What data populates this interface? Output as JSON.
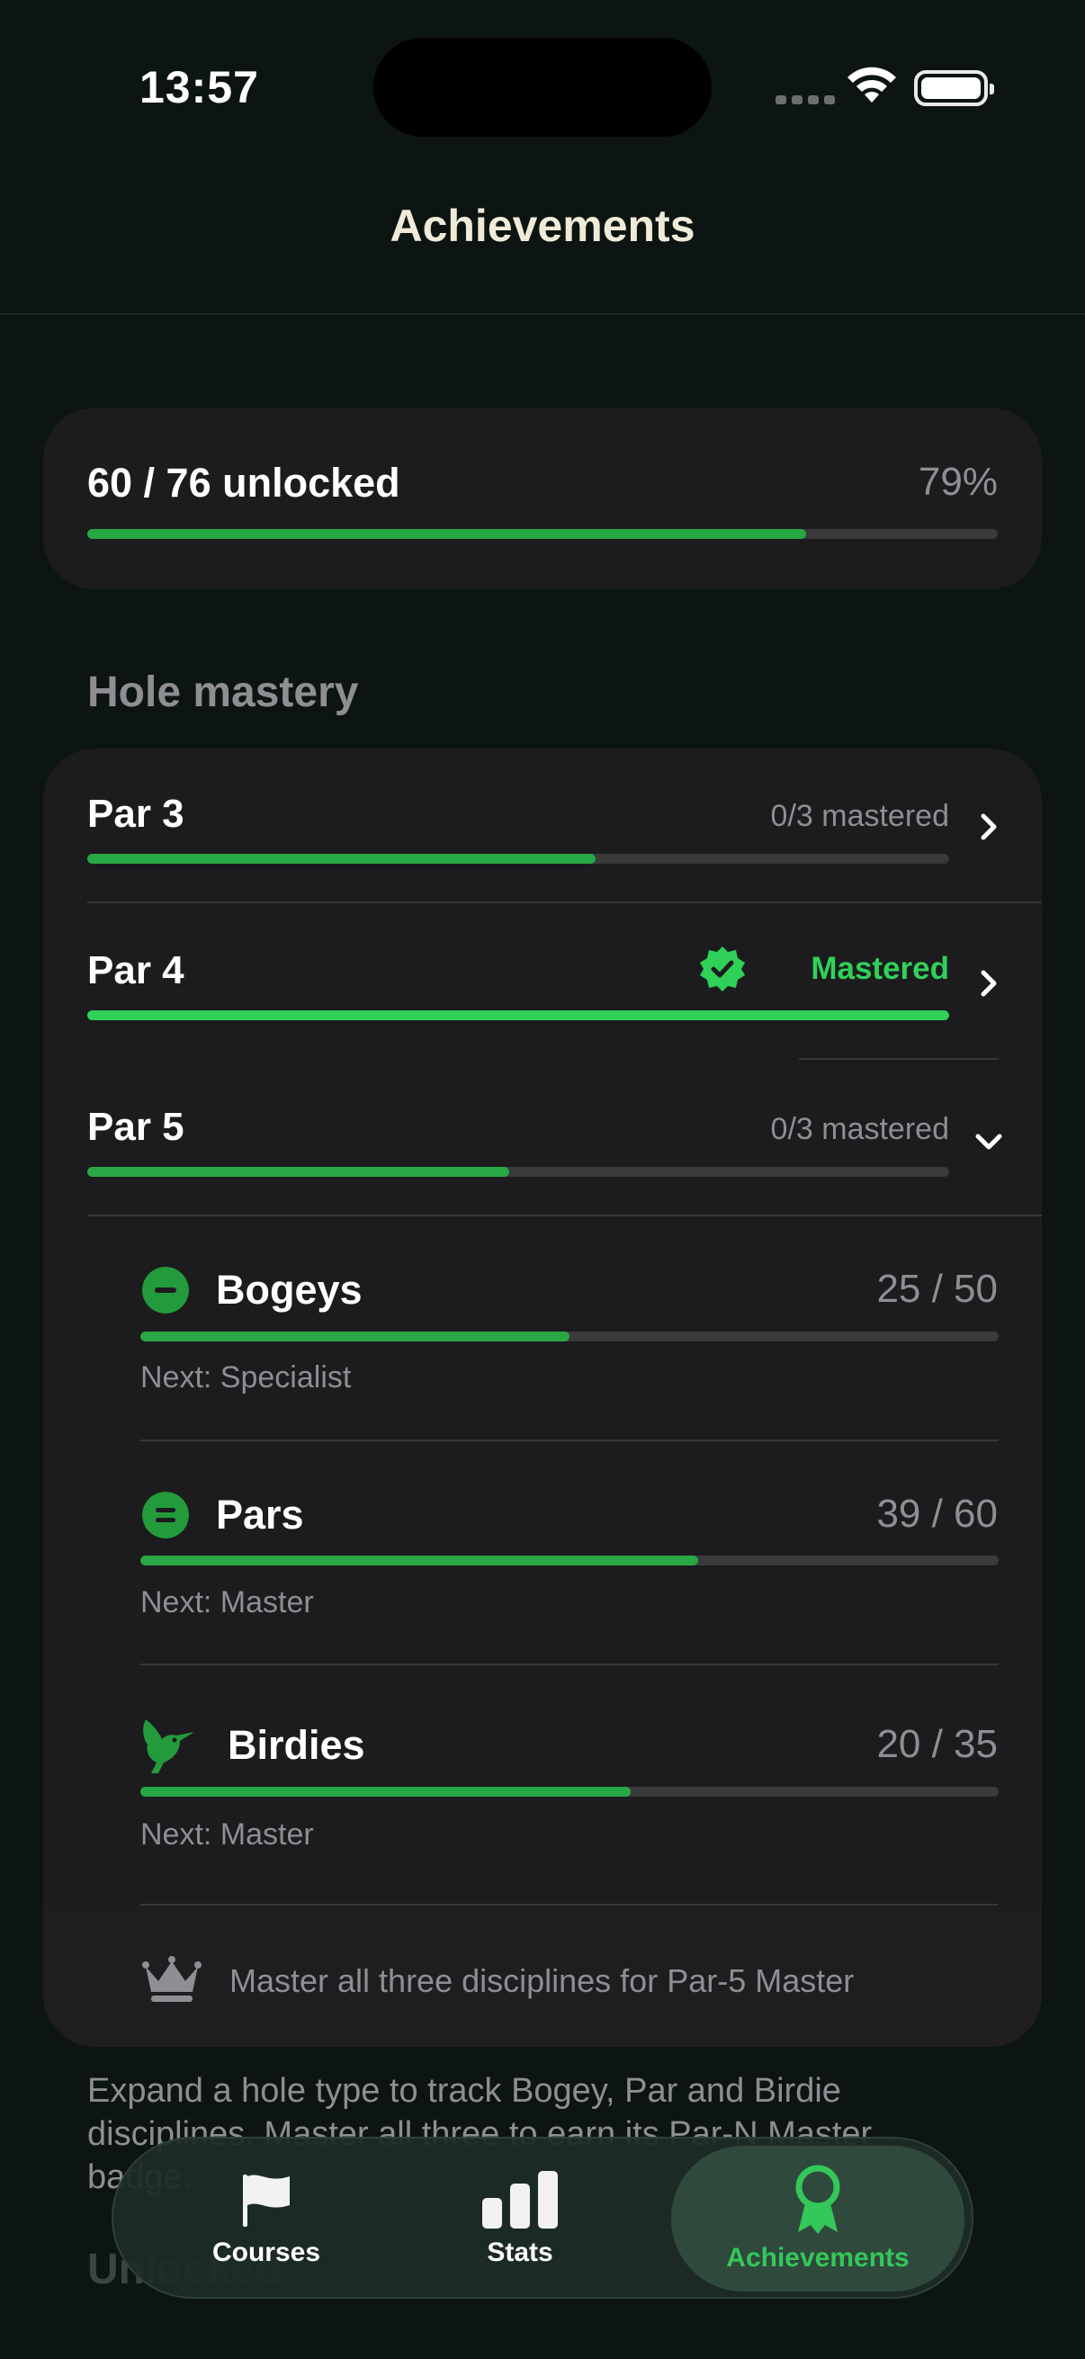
{
  "status_bar": {
    "time": "13:57"
  },
  "nav": {
    "title": "Achievements"
  },
  "summary": {
    "label": "60 / 76 unlocked",
    "percent_label": "79%",
    "progress": 0.79
  },
  "section": {
    "title": "Hole mastery"
  },
  "holes": [
    {
      "label": "Par 3",
      "status": "0/3 mastered",
      "progress": 0.59,
      "expanded": false,
      "mastered": false,
      "chevron": "chevron-right-icon"
    },
    {
      "label": "Par 4",
      "status": "Mastered",
      "progress": 1.0,
      "expanded": false,
      "mastered": true,
      "chevron": "chevron-right-icon"
    },
    {
      "label": "Par 5",
      "status": "0/3 mastered",
      "progress": 0.49,
      "expanded": true,
      "mastered": false,
      "chevron": "chevron-down-icon"
    }
  ],
  "disciplines": [
    {
      "icon": "minus-circle-icon",
      "label": "Bogeys",
      "count": "25 / 50",
      "progress": 0.5,
      "next": "Next: Specialist"
    },
    {
      "icon": "equals-circle-icon",
      "label": "Pars",
      "count": "39 / 60",
      "progress": 0.65,
      "next": "Next: Master"
    },
    {
      "icon": "bird-icon",
      "label": "Birdies",
      "count": "20 / 35",
      "progress": 0.571,
      "next": "Next: Master"
    }
  ],
  "footer_note": {
    "icon": "crown-icon",
    "text": "Master all three disciplines for Par-5 Master"
  },
  "explainer": "Expand a hole type to track Bogey, Par and Birdie disciplines. Master all three to earn its Par-N Master badge.",
  "next_section_heading": "Unlocked",
  "tabbar": [
    {
      "label": "Courses",
      "icon": "flag-icon",
      "active": false
    },
    {
      "label": "Stats",
      "icon": "bar-chart-icon",
      "active": false
    },
    {
      "label": "Achievements",
      "icon": "ribbon-award-icon",
      "active": true
    }
  ],
  "colors": {
    "accent": "#30d158",
    "progress": "#28a745",
    "background": "#0d1512",
    "card": "#1c1c1e"
  }
}
